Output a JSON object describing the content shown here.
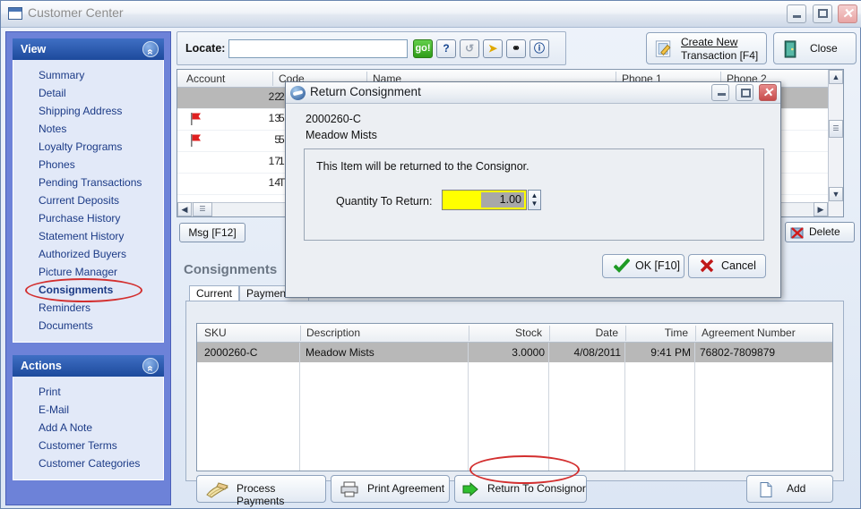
{
  "window": {
    "title": "Customer Center",
    "icon": "window-icon",
    "controls": {
      "minimize": "–",
      "maximize": "□",
      "close": "✕"
    }
  },
  "sidebar": {
    "view": {
      "header": "View",
      "collapse_icon": "chevron-up-icon",
      "items": [
        {
          "label": "Summary",
          "selected": false
        },
        {
          "label": "Detail",
          "selected": false
        },
        {
          "label": "Shipping Address",
          "selected": false
        },
        {
          "label": "Notes",
          "selected": false
        },
        {
          "label": "Loyalty Programs",
          "selected": false
        },
        {
          "label": "Phones",
          "selected": false
        },
        {
          "label": "Pending Transactions",
          "selected": false
        },
        {
          "label": "Current Deposits",
          "selected": false
        },
        {
          "label": "Purchase History",
          "selected": false
        },
        {
          "label": "Statement History",
          "selected": false
        },
        {
          "label": "Authorized Buyers",
          "selected": false
        },
        {
          "label": "Picture Manager",
          "selected": false
        },
        {
          "label": "Consignments",
          "selected": true
        },
        {
          "label": "Reminders",
          "selected": false
        },
        {
          "label": "Documents",
          "selected": false
        }
      ]
    },
    "actions": {
      "header": "Actions",
      "collapse_icon": "chevron-up-icon",
      "items": [
        {
          "label": "Print"
        },
        {
          "label": "E-Mail"
        },
        {
          "label": "Add A Note"
        },
        {
          "label": "Customer Terms"
        },
        {
          "label": "Customer Categories"
        }
      ]
    }
  },
  "toolbar": {
    "locate_label": "Locate:",
    "locate_value": "",
    "locate_placeholder": "",
    "go_label": "go!",
    "help_label": "?",
    "refresh_icon": "refresh-icon",
    "arrow_icon": "arrow-icon",
    "binoculars_icon": "binoculars-icon",
    "info_icon": "info-icon",
    "create_new_transaction": "Create New\nTransaction [F4]",
    "create_new_transaction_line1": "Create New",
    "create_new_transaction_line2": "Transaction [F4]",
    "create_icon": "edit-document-icon",
    "close_label": "Close",
    "close_icon": "exit-door-icon"
  },
  "customer_grid": {
    "columns": [
      "Account",
      "Code",
      "Name",
      "Phone 1",
      "Phone 2"
    ],
    "rows": [
      {
        "flag": false,
        "account": "22",
        "code": "22",
        "selected": true
      },
      {
        "flag": true,
        "account": "13",
        "code": "50",
        "selected": false
      },
      {
        "flag": true,
        "account": "5",
        "code": "5",
        "selected": false
      },
      {
        "flag": false,
        "account": "17",
        "code": "17",
        "selected": false
      },
      {
        "flag": false,
        "account": "14",
        "code": "T",
        "selected": false
      }
    ],
    "msg_button": "Msg [F12]",
    "delete_button": "Delete",
    "delete_icon": "delete-x-icon",
    "scroll_up": "▲",
    "scroll_down": "▼",
    "scroll_left": "◀",
    "scroll_right": "▶",
    "thumb_icon": "grip-icon"
  },
  "consignments": {
    "title": "Consignments",
    "tabs": [
      {
        "label": "Current",
        "active": true
      },
      {
        "label": "Payment Hi",
        "active": false
      }
    ],
    "columns": [
      "SKU",
      "Description",
      "Stock",
      "Date",
      "Time",
      "Agreement Number"
    ],
    "rows": [
      {
        "sku": "2000260-C",
        "description": "Meadow Mists",
        "stock": "3.0000",
        "date": "4/08/2011",
        "time": "9:41 PM",
        "agreement": "76802-7809879",
        "selected": true
      }
    ],
    "buttons": {
      "process_payments": "Process Payments",
      "process_payments_icon": "money-hand-icon",
      "print_agreement": "Print Agreement",
      "print_agreement_icon": "printer-icon",
      "return_to_consignor": "Return To Consignor",
      "return_to_consignor_icon": "green-arrow-icon",
      "add": "Add",
      "add_icon": "page-icon"
    }
  },
  "dialog": {
    "title": "Return Consignment",
    "icon": "app-logo-icon",
    "sku": "2000260-C",
    "item_name": "Meadow Mists",
    "message": "This Item will be returned to the Consignor.",
    "quantity_label": "Quantity To Return:",
    "quantity_value": "1.00",
    "spinner_up": "▲",
    "spinner_down": "▼",
    "ok_label": "OK [F10]",
    "ok_icon": "check-icon",
    "cancel_label": "Cancel",
    "cancel_icon": "x-icon",
    "controls": {
      "minimize": "–",
      "maximize": "□",
      "close": "✕"
    }
  },
  "colors": {
    "titlebar_accent": "#1d4a9c",
    "sidebar_bg": "#6d82d8",
    "highlight_circle": "#d32f2f",
    "go_green": "#2e9c18",
    "field_yellow": "#ffff00",
    "selected_row": "#b8b8b8"
  }
}
